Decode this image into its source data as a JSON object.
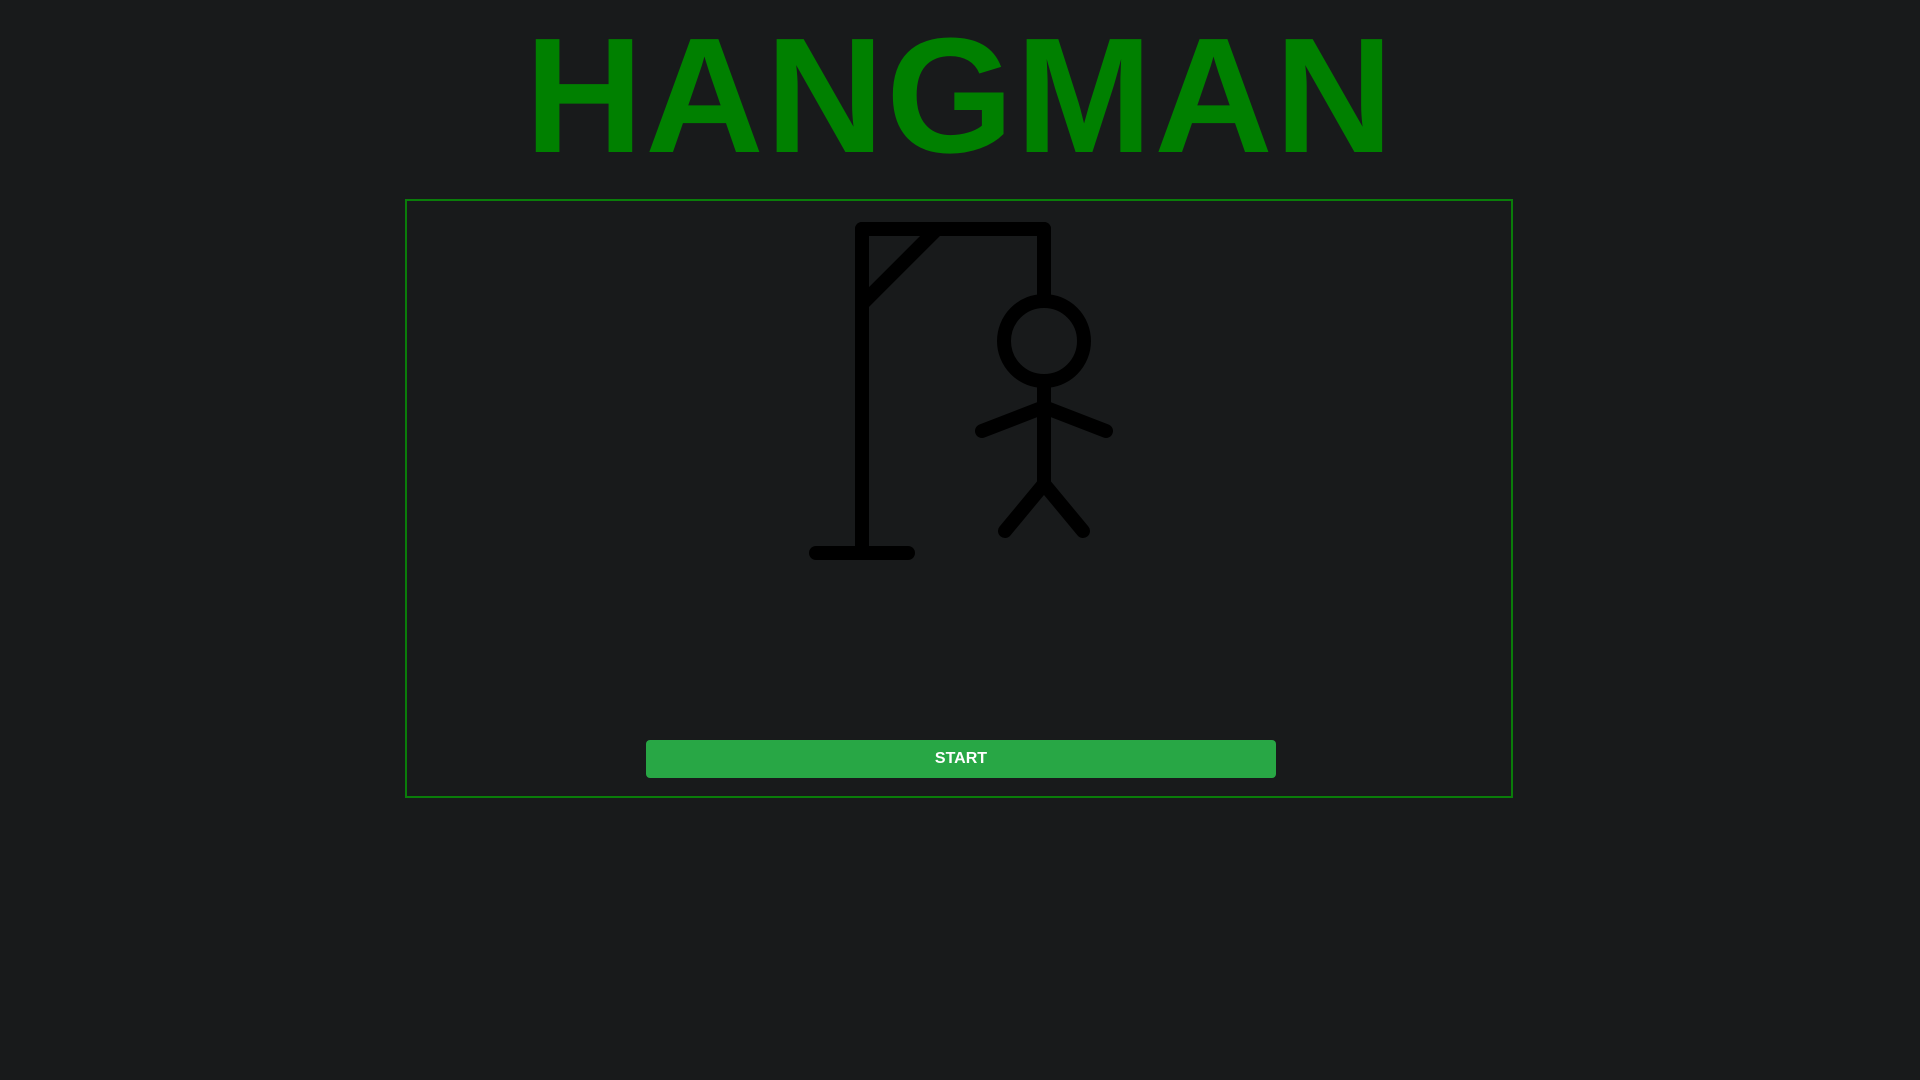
{
  "title": "HANGMAN",
  "start_button_label": "START",
  "colors": {
    "background": "#181a1b",
    "title": "#008000",
    "panel_border": "#0a7d0a",
    "button": "#28a745",
    "drawing": "#000000"
  },
  "hangman": {
    "parts_drawn": [
      "gallows",
      "head",
      "body",
      "left-arm",
      "right-arm",
      "left-leg",
      "right-leg"
    ]
  }
}
